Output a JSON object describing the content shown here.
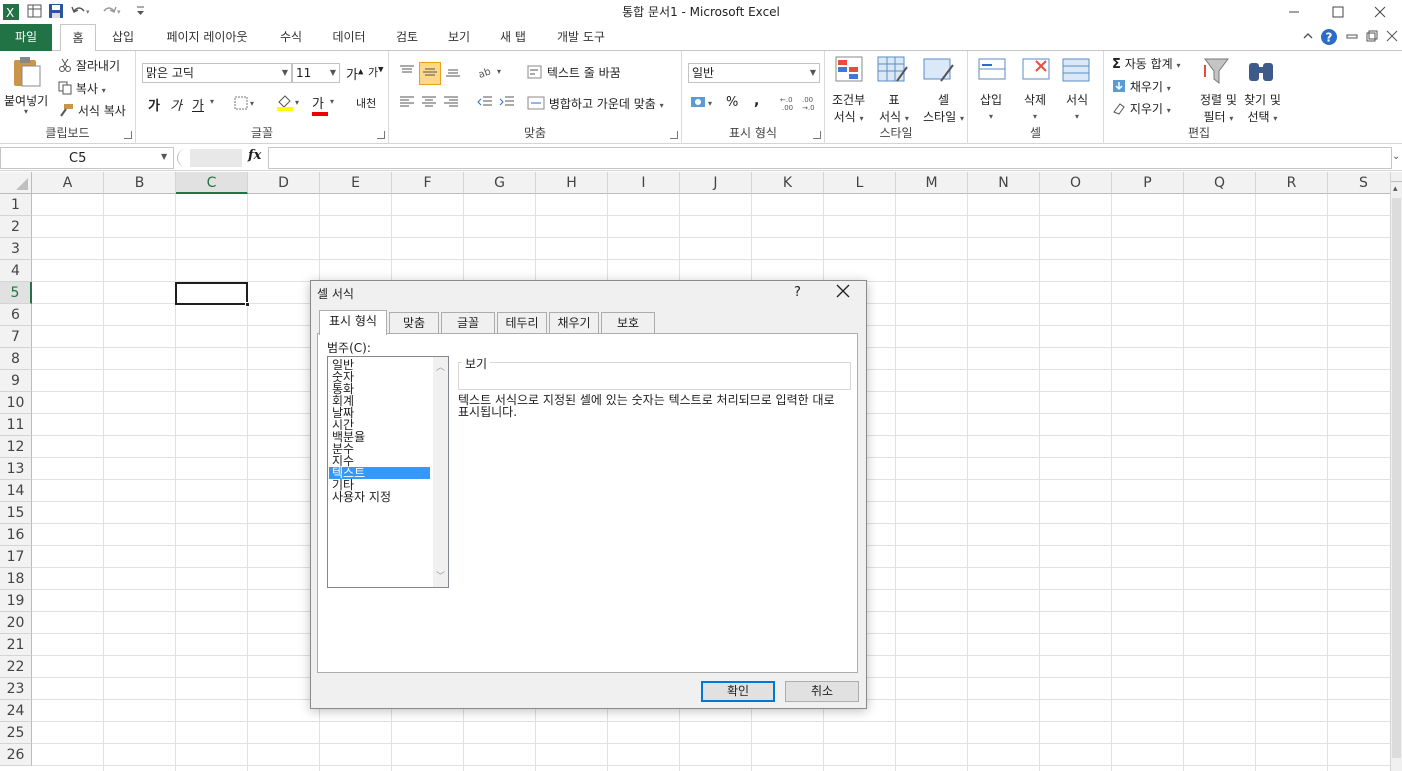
{
  "window": {
    "title": "통합 문서1  -  Microsoft Excel",
    "controls": [
      "minimize",
      "maximize",
      "close"
    ]
  },
  "tabs": [
    "파일",
    "홈",
    "삽입",
    "페이지 레이아웃",
    "수식",
    "데이터",
    "검토",
    "보기",
    "새 탭",
    "개발 도구"
  ],
  "active_tab": "홈",
  "ribbon": {
    "clipboard": {
      "label": "클립보드",
      "paste": "붙여넣기",
      "cut": "잘라내기",
      "copy": "복사",
      "format_painter": "서식 복사"
    },
    "font": {
      "label": "글꼴",
      "font_name": "맑은 고딕",
      "font_size": "11",
      "bold": "가",
      "italic": "가",
      "underline": "가",
      "font_color_glyph": "가",
      "phonetic_glyph": "내천"
    },
    "alignment": {
      "label": "맞춤",
      "wrap_text": "텍스트 줄 바꿈",
      "merge_center": "병합하고 가운데 맞춤"
    },
    "number": {
      "label": "표시 형식",
      "format": "일반",
      "percent": "%",
      "comma": ",",
      "inc_decimal": "+.0\n.00",
      "dec_decimal": ".00\n→.0"
    },
    "styles": {
      "label": "스타일",
      "conditional_line1": "조건부",
      "conditional_line2": "서식",
      "table_line1": "표",
      "table_line2": "서식",
      "cell_line1": "셀",
      "cell_line2": "스타일"
    },
    "cells": {
      "label": "셀",
      "insert": "삽입",
      "delete": "삭제",
      "format": "서식"
    },
    "editing": {
      "label": "편집",
      "autosum": "자동 합계",
      "fill": "채우기",
      "clear": "지우기",
      "sort_line1": "정렬 및",
      "sort_line2": "필터",
      "find_line1": "찾기 및",
      "find_line2": "선택"
    }
  },
  "formula_bar": {
    "name_box": "C5",
    "fx": "fx",
    "value": ""
  },
  "grid": {
    "columns": [
      "A",
      "B",
      "C",
      "D",
      "E",
      "F",
      "G",
      "H",
      "I",
      "J",
      "K",
      "L",
      "M",
      "N",
      "O",
      "P",
      "Q",
      "R",
      "S"
    ],
    "rows": [
      "1",
      "2",
      "3",
      "4",
      "5",
      "6",
      "7",
      "8",
      "9",
      "10",
      "11",
      "12",
      "13",
      "14",
      "15",
      "16",
      "17",
      "18",
      "19",
      "20",
      "21",
      "22",
      "23",
      "24",
      "25",
      "26"
    ],
    "selected_column": "C",
    "selected_row": "5"
  },
  "dialog": {
    "title": "셀 서식",
    "help": "?",
    "close": "✕",
    "tabs": [
      "표시 형식",
      "맞춤",
      "글꼴",
      "테두리",
      "채우기",
      "보호"
    ],
    "active_tab": "표시 형식",
    "category_label": "범주(C):",
    "categories": [
      "일반",
      "숫자",
      "통화",
      "회계",
      "날짜",
      "시간",
      "백분율",
      "분수",
      "지수",
      "텍스트",
      "기타",
      "사용자 지정"
    ],
    "selected_category": "텍스트",
    "sample_label": "보기",
    "description": "텍스트 서식으로 지정된 셀에 있는 숫자는 텍스트로 처리되므로 입력한 대로 표시됩니다.",
    "ok": "확인",
    "cancel": "취소"
  },
  "colors": {
    "accent": "#217346",
    "selection": "#3399ff"
  }
}
